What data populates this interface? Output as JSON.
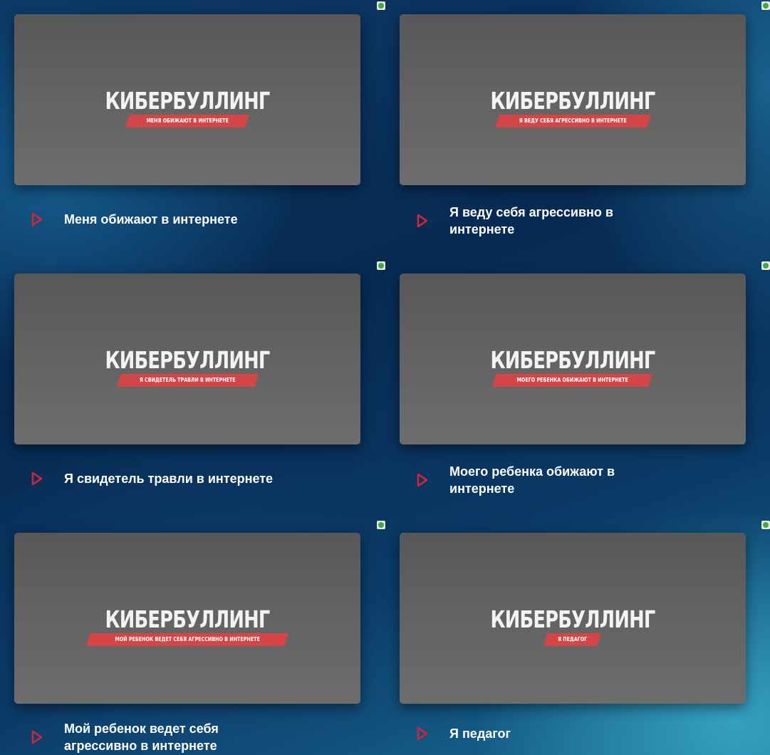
{
  "videos": [
    {
      "logo_title": "КИБЕРБУЛЛИНГ",
      "logo_subtitle": "МЕНЯ ОБИЖАЮТ В ИНТЕРНЕТЕ",
      "caption": "Меня обижают в интернете",
      "caption_line2": ""
    },
    {
      "logo_title": "КИБЕРБУЛЛИНГ",
      "logo_subtitle": "Я ВЕДУ СЕБЯ АГРЕССИВНО В ИНТЕРНЕТЕ",
      "caption": "Я веду себя агрессивно в",
      "caption_line2": "интернете"
    },
    {
      "logo_title": "КИБЕРБУЛЛИНГ",
      "logo_subtitle": "Я СВИДЕТЕЛЬ ТРАВЛИ В ИНТЕРНЕТЕ",
      "caption": "Я свидетель травли в интернете",
      "caption_line2": ""
    },
    {
      "logo_title": "КИБЕРБУЛЛИНГ",
      "logo_subtitle": "МОЕГО РЕБЕНКА ОБИЖАЮТ В ИНТЕРНЕТЕ",
      "caption": "Моего ребенка обижают в",
      "caption_line2": "интернете"
    },
    {
      "logo_title": "КИБЕРБУЛЛИНГ",
      "logo_subtitle": "МОЙ РЕБЕНОК ВЕДЕТ СЕБЯ АГРЕССИВНО В ИНТЕРНЕТЕ",
      "caption": "Мой ребенок ведет себя",
      "caption_line2": "агрессивно в интернете"
    },
    {
      "logo_title": "КИБЕРБУЛЛИНГ",
      "logo_subtitle": "Я ПЕДАГОГ",
      "caption": "Я педагог",
      "caption_line2": ""
    }
  ],
  "colors": {
    "play_icon": "#c8283c",
    "banner": "#d64545",
    "thumbnail": "#636363"
  },
  "icons": {
    "play": "play-triangle-outline-icon",
    "badge": "green-dot-badge-icon"
  }
}
